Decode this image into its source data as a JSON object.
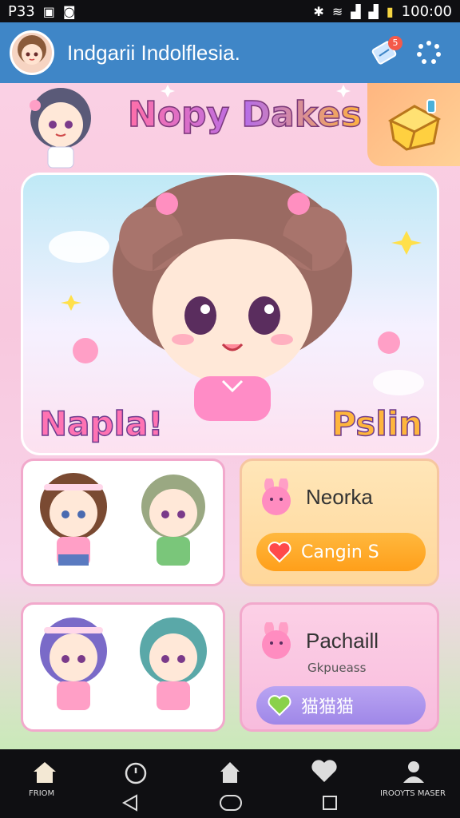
{
  "status_bar": {
    "left_text": "P33",
    "time": "100:00",
    "icons": [
      "gmail-icon",
      "chat-icon",
      "bluetooth-icon",
      "wifi-icon",
      "signal-icon",
      "signal-icon",
      "battery-icon"
    ]
  },
  "app_bar": {
    "title": "Indgarii Indolflesia.",
    "notification_count": "5",
    "icons": [
      "avatar",
      "ticket-icon",
      "loading-icon"
    ]
  },
  "banner": {
    "logo_text": "Nopy Dakes",
    "gift_icon": "gift-box-icon"
  },
  "hero": {
    "left_word": "Napla!",
    "right_word": "Pslin"
  },
  "cards": [
    {
      "kind": "characters",
      "count": 2
    },
    {
      "kind": "action",
      "title": "Neorka",
      "button_label": "Cangin S",
      "icon": "heart-icon"
    },
    {
      "kind": "characters",
      "count": 2
    },
    {
      "kind": "action",
      "title": "Pachaill",
      "subtitle": "Gkpueass",
      "button_label": "猫猫猫",
      "icon": "heart-icon"
    }
  ],
  "nav": {
    "items": [
      {
        "label": "FRIOM",
        "icon": "home-icon"
      },
      {
        "label": "",
        "icon": "timer-icon"
      },
      {
        "label": "",
        "icon": "house-icon"
      },
      {
        "label": "",
        "icon": "heart-icon"
      },
      {
        "label": "IROOYTS MASER",
        "icon": "person-icon"
      }
    ],
    "system": [
      "back-icon",
      "home-circle-icon",
      "recents-icon"
    ]
  },
  "colors": {
    "app_bar": "#3f86c7",
    "accent_pink": "#f2a9cc",
    "accent_orange": "#ff9f1a",
    "accent_purple": "#9f87e8"
  }
}
